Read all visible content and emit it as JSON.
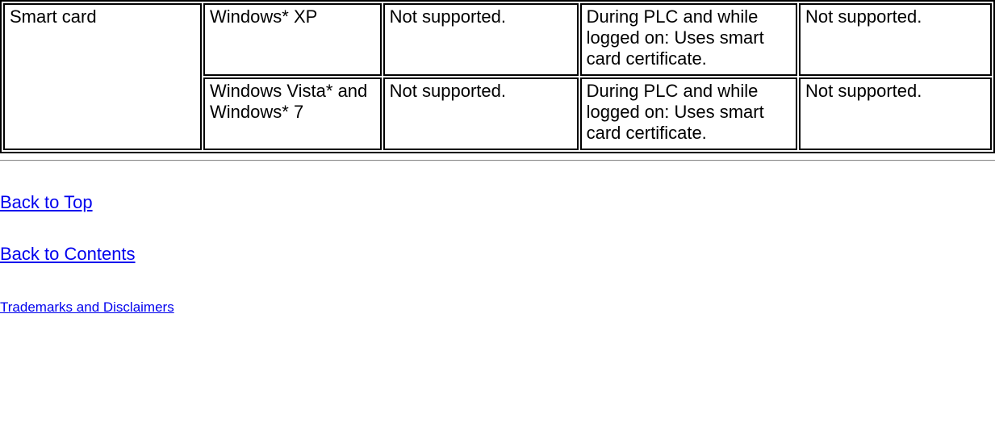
{
  "table": {
    "rows": [
      {
        "c1": "Smart card",
        "c2": "Windows* XP",
        "c3": "Not supported.",
        "c4": "During PLC and while logged on: Uses smart card certificate.",
        "c5": "Not supported."
      },
      {
        "c2": "Windows Vista* and Windows* 7",
        "c3": "Not supported.",
        "c4": "During PLC and while logged on: Uses smart card certificate.",
        "c5": "Not supported."
      }
    ]
  },
  "links": {
    "back_to_top": "Back to Top",
    "back_to_contents": "Back to Contents",
    "trademarks": "Trademarks and Disclaimers"
  }
}
